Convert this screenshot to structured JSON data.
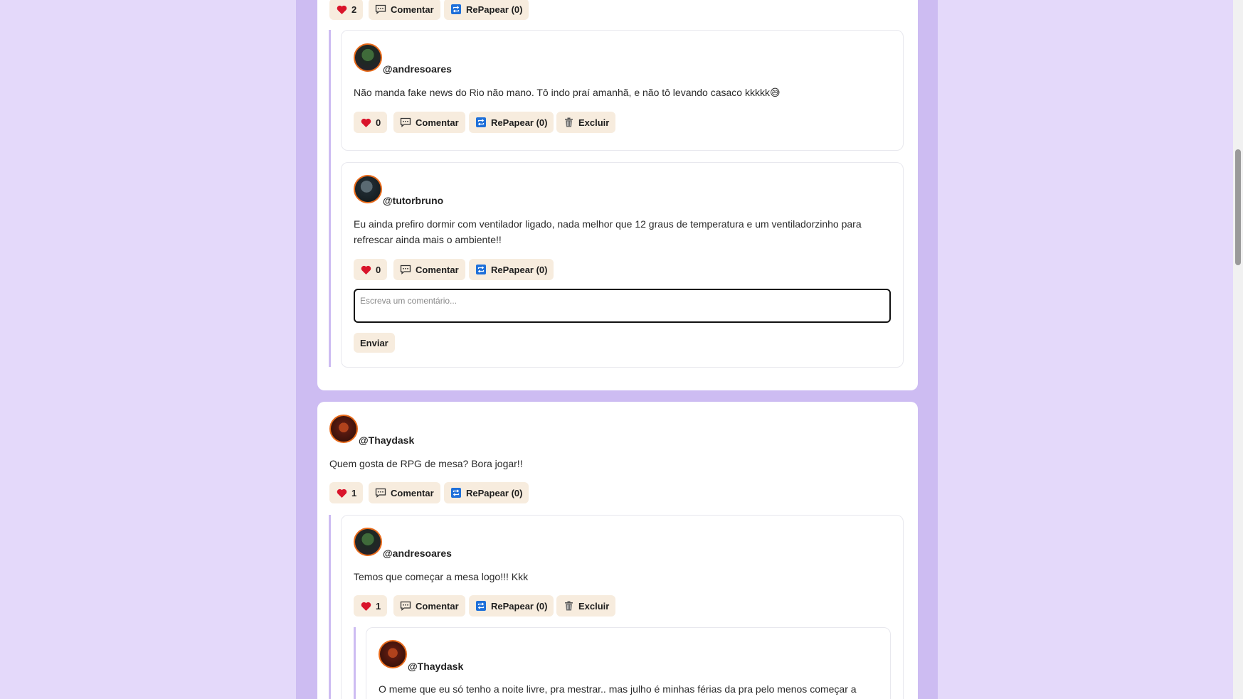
{
  "post_top": {
    "actions": {
      "likes": "2",
      "comment": "Comentar",
      "repaper": "RePapear (0)"
    },
    "replies": [
      {
        "username": "@andresoares",
        "text": "Não manda fake news do Rio não mano. Tô indo praí amanhã, e não tô levando casaco kkkkk😅",
        "likes": "0",
        "comment": "Comentar",
        "repaper": "RePapear (0)",
        "delete": "Excluir"
      },
      {
        "username": "@tutorbruno",
        "text": "Eu ainda prefiro dormir com ventilador ligado, nada melhor que 12 graus de temperatura e um ventiladorzinho para refrescar ainda mais o ambiente!!",
        "likes": "0",
        "comment": "Comentar",
        "repaper": "RePapear (0)",
        "comment_placeholder": "Escreva um comentário...",
        "send": "Enviar"
      }
    ]
  },
  "post_bottom": {
    "username": "@Thaydask",
    "text": "Quem gosta de RPG de mesa? Bora jogar!!",
    "actions": {
      "likes": "1",
      "comment": "Comentar",
      "repaper": "RePapear (0)"
    },
    "reply": {
      "username": "@andresoares",
      "text": "Temos que começar a mesa logo!!! Kkk",
      "likes": "1",
      "comment": "Comentar",
      "repaper": "RePapear (0)",
      "delete": "Excluir",
      "nested": {
        "username": "@Thaydask",
        "text": "O meme que eu só tenho a noite livre, pra mestrar.. mas julho é minhas férias da pra pelo menos começar a"
      }
    }
  },
  "icons": {
    "like": "heart-icon",
    "comment": "speech-bubble-icon",
    "repaper": "repost-icon",
    "delete": "trash-icon"
  },
  "colors": {
    "page_bg": "#e4d9fa",
    "column_bg": "#cdbcf2",
    "button_bg": "#f7ecde",
    "heart": "#d9142b",
    "repost": "#1e6fd9",
    "avatar_ring": "#e86a1a"
  }
}
